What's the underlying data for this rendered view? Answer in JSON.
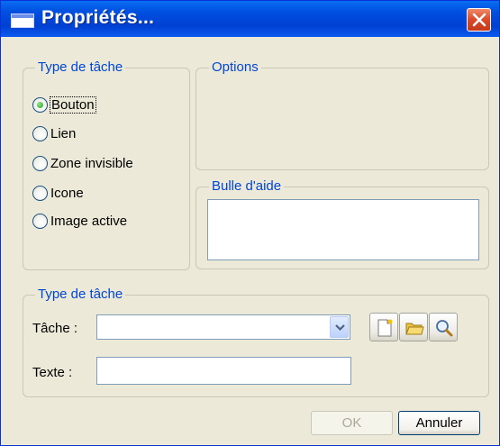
{
  "window": {
    "title": "Propriétés..."
  },
  "task_type_group": {
    "legend": "Type de tâche",
    "options": [
      {
        "label": "Bouton",
        "checked": true
      },
      {
        "label": "Lien",
        "checked": false
      },
      {
        "label": "Zone invisible",
        "checked": false
      },
      {
        "label": "Icone",
        "checked": false
      },
      {
        "label": "Image active",
        "checked": false
      }
    ]
  },
  "options_group": {
    "legend": "Options"
  },
  "tooltip_group": {
    "legend": "Bulle d'aide",
    "value": ""
  },
  "task_group": {
    "legend": "Type de tâche",
    "task_label": "Tâche :",
    "task_value": "",
    "text_label": "Texte :",
    "text_value": ""
  },
  "buttons": {
    "ok": "OK",
    "cancel": "Annuler"
  }
}
